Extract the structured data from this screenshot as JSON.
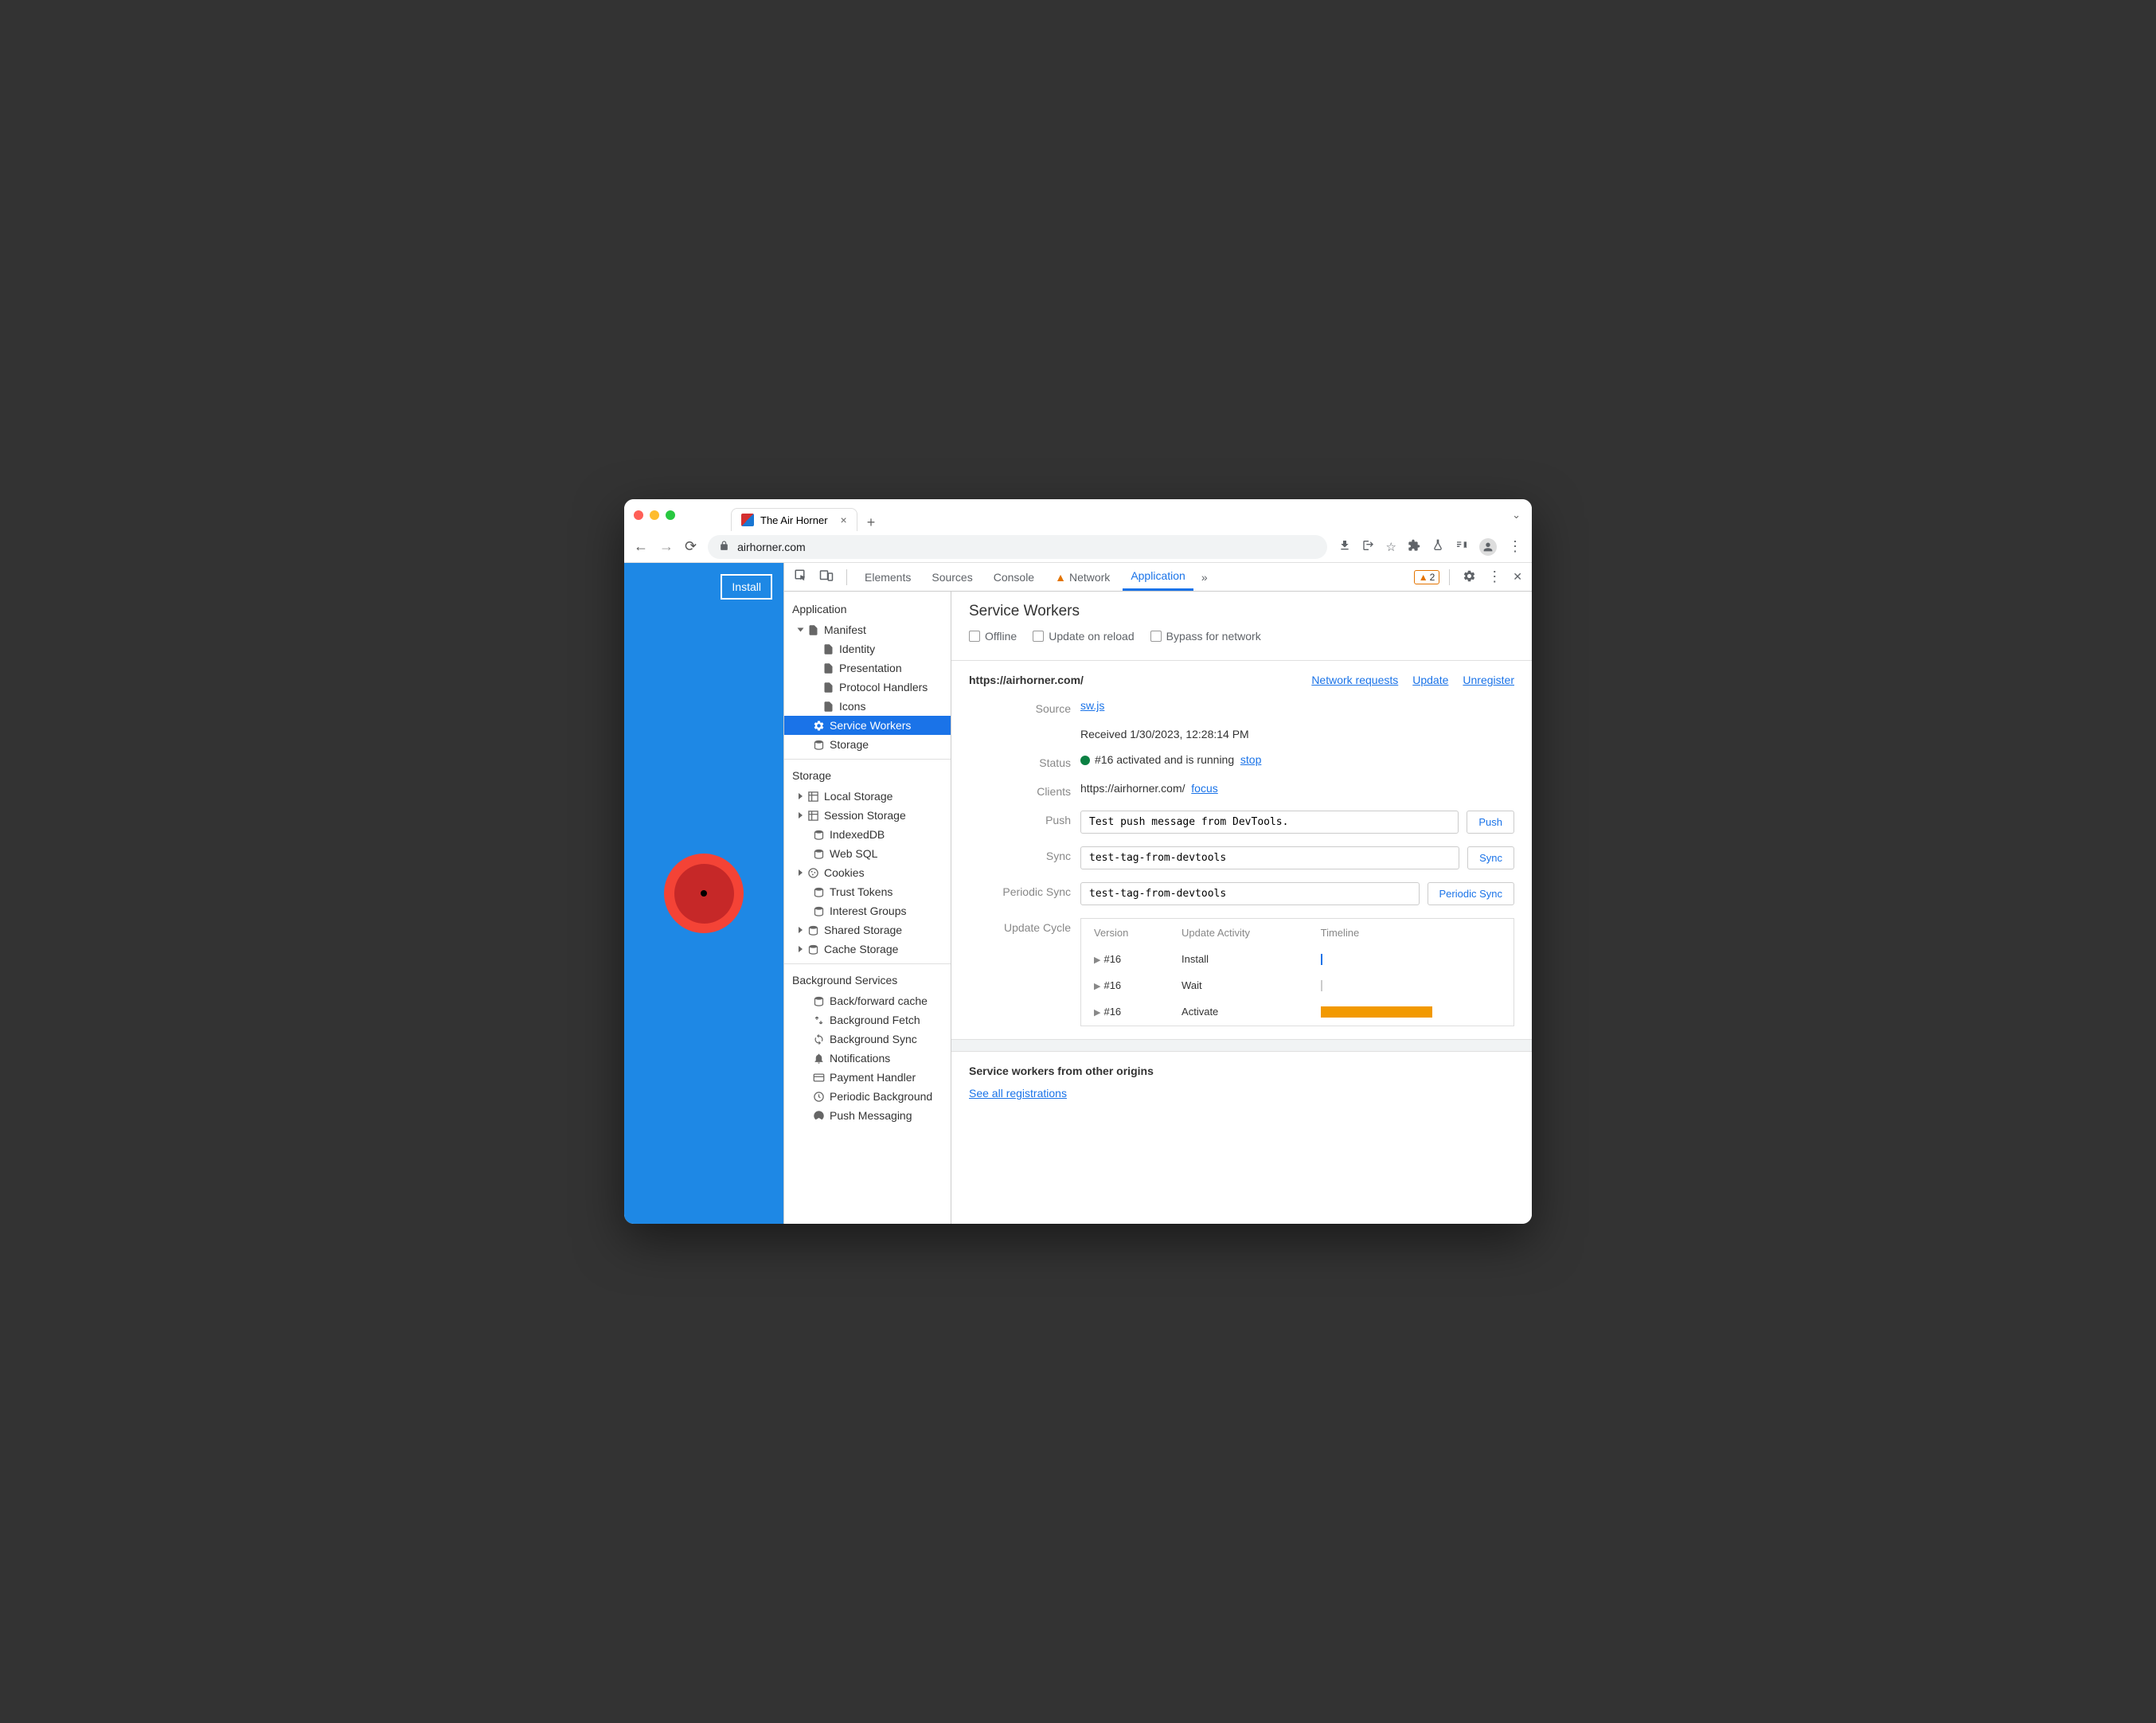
{
  "tab": {
    "title": "The Air Horner"
  },
  "address": {
    "host": "airhorner.com"
  },
  "page": {
    "install": "Install"
  },
  "devtools": {
    "tabs": {
      "elements": "Elements",
      "sources": "Sources",
      "console": "Console",
      "network": "Network",
      "application": "Application"
    },
    "warnings": "2",
    "sidebar": {
      "application": "Application",
      "manifest": "Manifest",
      "identity": "Identity",
      "presentation": "Presentation",
      "protocol": "Protocol Handlers",
      "icons": "Icons",
      "serviceworkers": "Service Workers",
      "storage_item": "Storage",
      "storage": "Storage",
      "local": "Local Storage",
      "session": "Session Storage",
      "indexeddb": "IndexedDB",
      "websql": "Web SQL",
      "cookies": "Cookies",
      "trust": "Trust Tokens",
      "interest": "Interest Groups",
      "shared": "Shared Storage",
      "cache": "Cache Storage",
      "bg": "Background Services",
      "bfcache": "Back/forward cache",
      "bgfetch": "Background Fetch",
      "bgsync": "Background Sync",
      "notif": "Notifications",
      "payment": "Payment Handler",
      "periodic": "Periodic Background",
      "push": "Push Messaging"
    },
    "main": {
      "title": "Service Workers",
      "offline": "Offline",
      "update_reload": "Update on reload",
      "bypass": "Bypass for network",
      "origin": "https://airhorner.com/",
      "network_requests": "Network requests",
      "update": "Update",
      "unregister": "Unregister",
      "labels": {
        "source": "Source",
        "status": "Status",
        "clients": "Clients",
        "push": "Push",
        "sync": "Sync",
        "periodic": "Periodic Sync",
        "cycle": "Update Cycle"
      },
      "source_file": "sw.js",
      "received": "Received 1/30/2023, 12:28:14 PM",
      "status_text": "#16 activated and is running",
      "stop": "stop",
      "client_url": "https://airhorner.com/",
      "focus": "focus",
      "push_value": "Test push message from DevTools.",
      "push_btn": "Push",
      "sync_value": "test-tag-from-devtools",
      "sync_btn": "Sync",
      "periodic_value": "test-tag-from-devtools",
      "periodic_btn": "Periodic Sync",
      "cycle_headers": {
        "version": "Version",
        "activity": "Update Activity",
        "timeline": "Timeline"
      },
      "cycle_rows": [
        {
          "version": "#16",
          "activity": "Install"
        },
        {
          "version": "#16",
          "activity": "Wait"
        },
        {
          "version": "#16",
          "activity": "Activate"
        }
      ],
      "other_title": "Service workers from other origins",
      "see_all": "See all registrations"
    }
  }
}
